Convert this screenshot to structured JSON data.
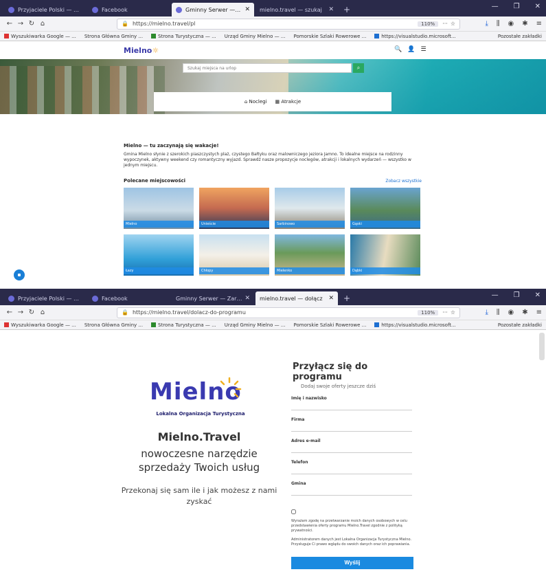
{
  "browser": {
    "window1": {
      "tabs": [
        {
          "label": "Przyjaciele Polski — Wyniki ×"
        },
        {
          "label": "Facebook"
        },
        {
          "label": "Gminny Serwer — Zarząd"
        },
        {
          "label": "mielno.travel — szukaj"
        }
      ],
      "url": "https://mielno.travel/pl",
      "zoom": "110%"
    },
    "window2": {
      "tabs": [
        {
          "label": "Przyjaciele Polski — Wyniki ×"
        },
        {
          "label": "Facebook"
        },
        {
          "label": "Gminny Serwer — Zarząd"
        },
        {
          "label": "mielno.travel — dołącz"
        }
      ],
      "url": "https://mielno.travel/dolacz-do-programu",
      "zoom": "110%"
    },
    "bookmarks": [
      {
        "label": "Wyszukiwarka Google — ...",
        "color": "#1d6fd1"
      },
      {
        "label": "Strona Główna Gminy ..."
      },
      {
        "label": "Strona Turystyczna — ...",
        "color": "#2c8a2c"
      },
      {
        "label": "Urząd Gminy Mielno — ..."
      },
      {
        "label": "Pomorskie Szlaki Rowerowe ..."
      },
      {
        "label": "https://visualstudio.microsoft..."
      }
    ],
    "bookmarks_right": "Pozostałe zakładki"
  },
  "site": {
    "logo": "Mielno",
    "search_placeholder": "Szukaj miejsca na urlop",
    "tabs": [
      "Noclegi",
      "Atrakcje"
    ],
    "intro_title": "Mielno — tu zaczynają się wakacje!",
    "intro_text": "Gmina Mielno słynie z szerokich piaszczystych plaż, czystego Bałtyku oraz malowniczego jeziora Jamno. To idealne miejsce na rodzinny wypoczynek, aktywny weekend czy romantyczny wyjazd. Sprawdź nasze propozycje noclegów, atrakcji i lokalnych wydarzeń — wszystko w jednym miejscu.",
    "section_title": "Polecane miejscowości",
    "section_more": "Zobacz wszystkie",
    "cards": [
      {
        "label": "Mielno"
      },
      {
        "label": "Unieście"
      },
      {
        "label": "Sarbinowo"
      },
      {
        "label": "Gąski"
      },
      {
        "label": "Łazy"
      },
      {
        "label": "Chłopy"
      },
      {
        "label": "Mielenko"
      },
      {
        "label": "Dąbki"
      }
    ]
  },
  "join": {
    "logo_text": "Mielno",
    "logo_sub": "Lokalna Organizacja Turystyczna",
    "headline": "Mielno.Travel",
    "subline": "nowoczesne narzędzie sprzedaży Twoich usług",
    "small": "Przekonaj się sam ile i jak możesz z nami zyskać",
    "form_title": "Przyłącz się do programu",
    "form_lead": "Dodaj swoje oferty jeszcze dziś",
    "fields": [
      {
        "label": "Imię i nazwisko"
      },
      {
        "label": "Firma"
      },
      {
        "label": "Adres e-mail"
      },
      {
        "label": "Telefon"
      },
      {
        "label": "Gmina"
      }
    ],
    "terms": "Wyrażam zgodę na przetwarzanie moich danych osobowych w celu przedstawienia oferty programu Mielno.Travel zgodnie z polityką prywatności.",
    "terms2": "Administratorem danych jest Lokalna Organizacja Turystyczna Mielno. Przysługuje Ci prawo wglądu do swoich danych oraz ich poprawiania.",
    "send": "Wyślij"
  }
}
